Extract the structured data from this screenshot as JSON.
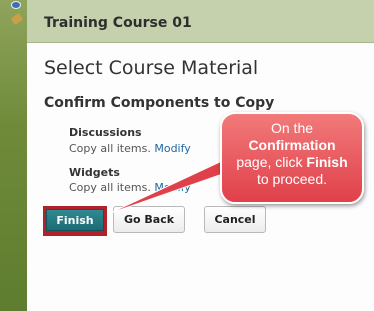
{
  "header": {
    "course_title": "Training Course 01"
  },
  "page": {
    "title": "Select Course Material",
    "section_heading": "Confirm Components to Copy"
  },
  "components": [
    {
      "label": "Discussions",
      "description": "Copy all items.",
      "modify_label": "Modify"
    },
    {
      "label": "Widgets",
      "description": "Copy all items.",
      "modify_label": "Modify"
    }
  ],
  "buttons": {
    "finish": "Finish",
    "go_back": "Go Back",
    "cancel": "Cancel"
  },
  "callout": {
    "line1": "On the",
    "line2_bold": "Confirmation",
    "line3_pre": "page, click",
    "line3_bold": "Finish",
    "line4": "to proceed."
  },
  "colors": {
    "header_bg": "#c5d1ad",
    "finish_button": "#1d6b74",
    "callout": "#e0404a",
    "highlight": "#b0222b",
    "link": "#1f67a8"
  },
  "icons": [
    "globe-icon",
    "pencil-icon"
  ]
}
